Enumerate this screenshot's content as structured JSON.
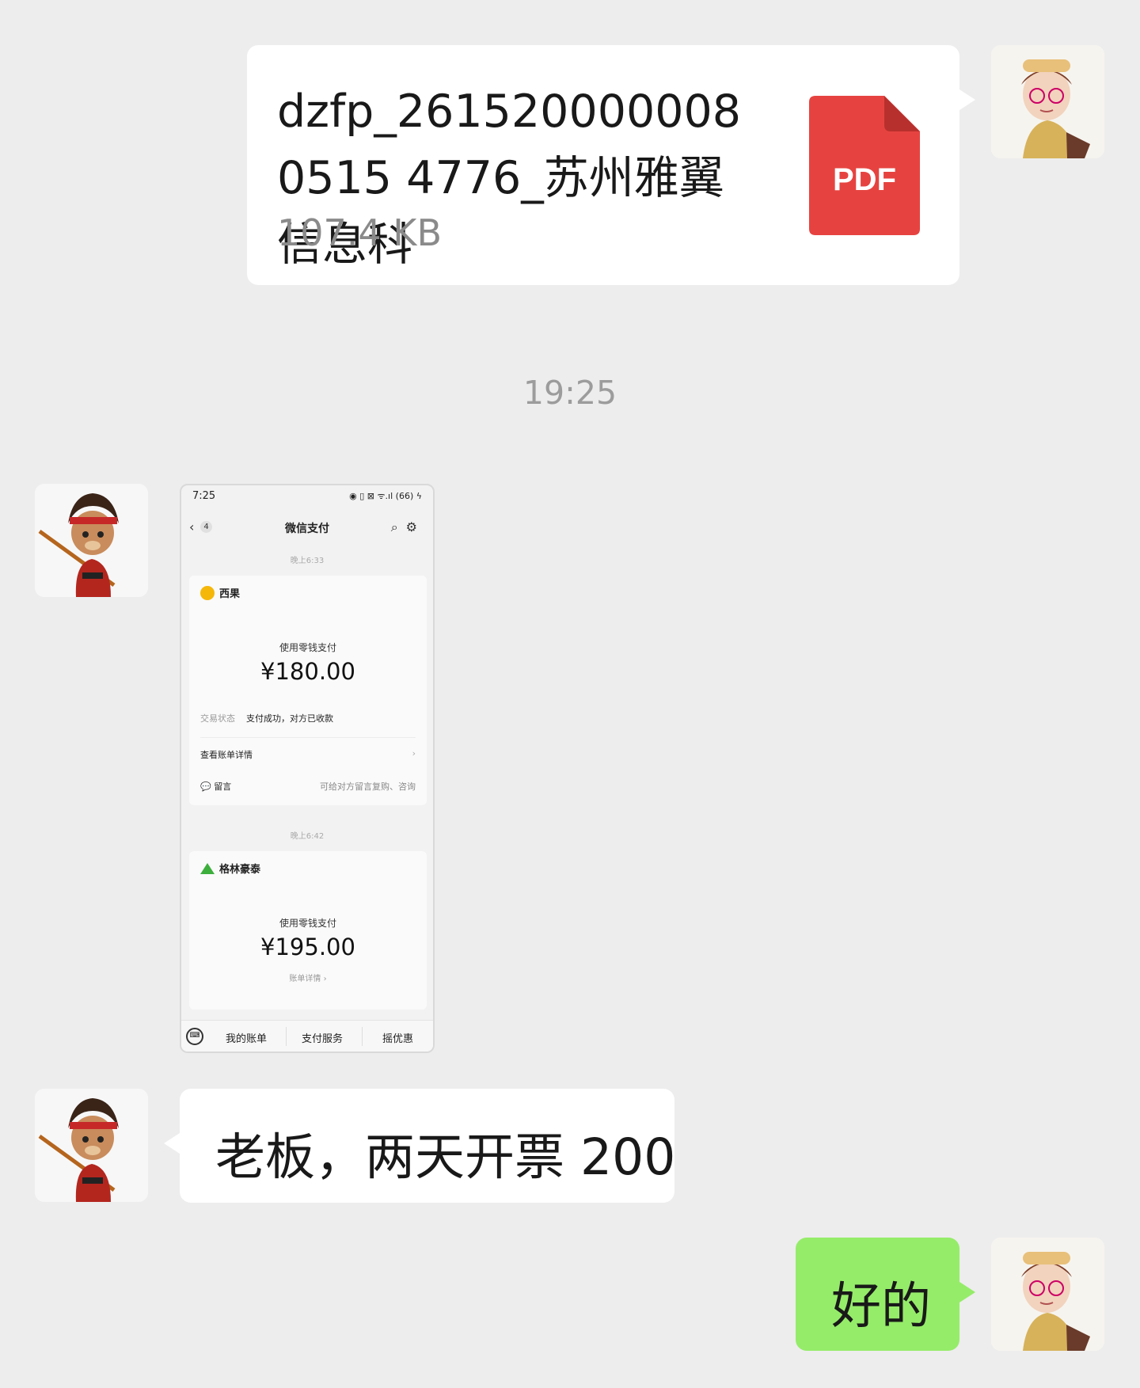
{
  "messages": {
    "file": {
      "filename": "dzfp_2615200000080515 4776_苏州雅翼信息科",
      "size": "107.4 KB",
      "file_type": "PDF",
      "icon": "pdf-file-icon",
      "accent": "#e64340"
    },
    "timestamp": "19:25",
    "screenshot": {
      "status_time": "7:25",
      "status_icons": "◉ ▯ ⊠ ᯤ.ıl (66) ϟ",
      "title": "微信支付",
      "back_count": "4",
      "tstamp1": "晚上6:33",
      "payment1": {
        "merchant": "西果",
        "method": "使用零钱支付",
        "amount": "¥180.00",
        "status_label": "交易状态",
        "status_value": "支付成功，对方已收款",
        "detail_label": "查看账单详情",
        "message_label": "留言",
        "message_hint": "可给对方留言复购、咨询"
      },
      "tstamp2": "晚上6:42",
      "payment2": {
        "merchant": "格林豪泰",
        "method": "使用零钱支付",
        "amount": "¥195.00",
        "detail_link": "账单详情 ›"
      },
      "tabs": [
        "我的账单",
        "支付服务",
        "摇优惠"
      ]
    },
    "text_left": "老板，两天开票 200",
    "text_right": "好的"
  },
  "colors": {
    "background": "#ededed",
    "bubble_white": "#ffffff",
    "bubble_green": "#95ec69"
  }
}
